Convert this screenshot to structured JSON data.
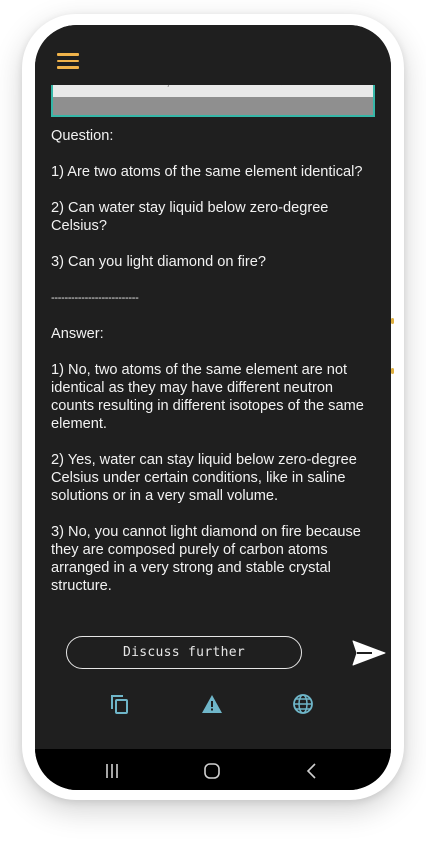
{
  "app_bar": {
    "menu_icon": "hamburger-menu-icon"
  },
  "content": {
    "question_label": "Question:",
    "questions": [
      " 1) Are two atoms of the same element identical?",
      "2) Can water stay liquid below zero-degree Celsius?",
      "3) Can you light diamond on fire?"
    ],
    "separator": "--------------------------",
    "answer_label": "Answer:",
    "answers": [
      "1) No, two atoms of the same element are not identical as they may have different neutron counts resulting in different isotopes of the same element.",
      "2) Yes, water can stay liquid below zero-degree Celsius under certain conditions, like in saline solutions or in a very small volume.",
      "3) No, you cannot light diamond on fire because they are composed purely of carbon atoms arranged in a very strong and stable crystal structure."
    ]
  },
  "input": {
    "discuss_label": "Discuss further",
    "send_icon": "send-icon"
  },
  "toolbar": {
    "icons": [
      "copy-icon",
      "warning-icon",
      "globe-icon"
    ]
  },
  "system_nav": {
    "icons": [
      "recents-icon",
      "home-icon",
      "back-icon"
    ]
  },
  "colors": {
    "background": "#1f1f1f",
    "accent": "#f0b34a",
    "frame": "#36b7a8",
    "text": "#f2f2f2"
  }
}
